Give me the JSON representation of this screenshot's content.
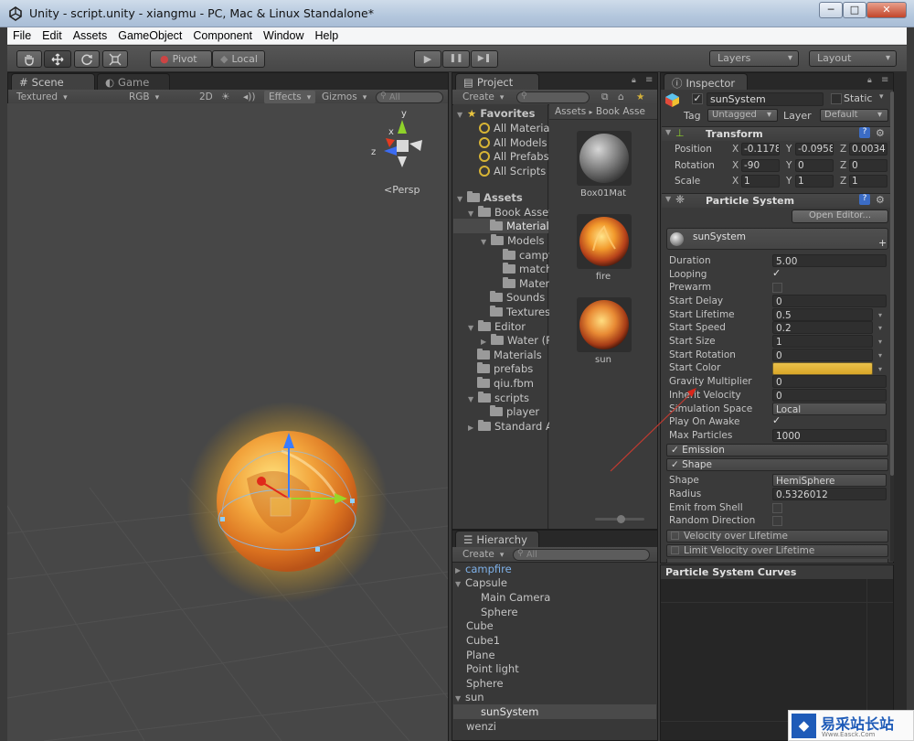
{
  "window": {
    "title": "Unity - script.unity - xiangmu - PC, Mac & Linux Standalone*",
    "controls": [
      "─",
      "□",
      "✕"
    ]
  },
  "menu": [
    "File",
    "Edit",
    "Assets",
    "GameObject",
    "Component",
    "Window",
    "Help"
  ],
  "toolbar": {
    "pivot": "Pivot",
    "local": "Local",
    "play": "▶",
    "pause": "❚❚",
    "step": "▶❚",
    "layers": "Layers",
    "layout": "Layout"
  },
  "scene": {
    "tabs": [
      "Scene",
      "Game"
    ],
    "shading": "Textured",
    "color": "RGB",
    "mode2d": "2D",
    "effects": "Effects",
    "gizmos": "Gizmos",
    "search": "All",
    "persp": "Persp",
    "gizmo_axes": {
      "x": "x",
      "y": "y",
      "z": "z"
    }
  },
  "project": {
    "tab": "Project",
    "create": "Create",
    "breadcrumb": [
      "Assets",
      "Book Asse"
    ],
    "favorites_label": "Favorites",
    "favorites": [
      "All Material",
      "All Models",
      "All Prefabs",
      "All Scripts"
    ],
    "assets_label": "Assets",
    "tree": [
      "Book Asset",
      "Materials",
      "Models",
      "campf",
      "match",
      "Materi",
      "Sounds",
      "Textures",
      "Editor",
      "Water (P",
      "Materials",
      "prefabs",
      "qiu.fbm",
      "scripts",
      "player",
      "Standard A"
    ],
    "thumbs": [
      "Box01Mat",
      "fire",
      "sun"
    ]
  },
  "hierarchy": {
    "tab": "Hierarchy",
    "create": "Create",
    "search": "All",
    "items": [
      "campfire",
      "Capsule",
      "Main Camera",
      "Sphere",
      "Cube",
      "Cube1",
      "Plane",
      "Point light",
      "Sphere",
      "sun",
      "sunSystem",
      "wenzi"
    ]
  },
  "inspector": {
    "tab": "Inspector",
    "object_name": "sunSystem",
    "static": "Static",
    "tag_label": "Tag",
    "tag": "Untagged",
    "layer_label": "Layer",
    "layer": "Default",
    "transform": {
      "title": "Transform",
      "rows": [
        {
          "label": "Position",
          "x": "-0.1178",
          "y": "-0.0958",
          "z": "0.0034"
        },
        {
          "label": "Rotation",
          "x": "-90",
          "y": "0",
          "z": "0"
        },
        {
          "label": "Scale",
          "x": "1",
          "y": "1",
          "z": "1"
        }
      ],
      "axis": [
        "X",
        "Y",
        "Z"
      ]
    },
    "particle": {
      "title": "Particle System",
      "open_editor": "Open Editor...",
      "system_name": "sunSystem",
      "props": [
        {
          "label": "Duration",
          "value": "5.00"
        },
        {
          "label": "Looping",
          "value": "✓"
        },
        {
          "label": "Prewarm",
          "value": ""
        },
        {
          "label": "Start Delay",
          "value": "0"
        },
        {
          "label": "Start Lifetime",
          "value": "0.5"
        },
        {
          "label": "Start Speed",
          "value": "0.2"
        },
        {
          "label": "Start Size",
          "value": "1"
        },
        {
          "label": "Start Rotation",
          "value": "0"
        },
        {
          "label": "Start Color",
          "value": ""
        },
        {
          "label": "Gravity Multiplier",
          "value": "0"
        },
        {
          "label": "Inherit Velocity",
          "value": "0"
        },
        {
          "label": "Simulation Space",
          "value": "Local"
        },
        {
          "label": "Play On Awake",
          "value": "✓"
        },
        {
          "label": "Max Particles",
          "value": "1000"
        }
      ],
      "emission": "Emission",
      "shape": "Shape",
      "shape_props": [
        {
          "label": "Shape",
          "value": "HemiSphere"
        },
        {
          "label": "Radius",
          "value": "0.5326012"
        },
        {
          "label": "Emit from Shell",
          "value": ""
        },
        {
          "label": "Random Direction",
          "value": ""
        }
      ],
      "modules": [
        "Velocity over Lifetime",
        "Limit Velocity over Lifetime"
      ]
    },
    "curves_title": "Particle System Curves"
  },
  "watermark": {
    "brand": "易采站长站",
    "sub": "Www.Easck.Com"
  },
  "colors": {
    "start_color": "#e8b63a",
    "selected_row": "#4a4a4a",
    "prefab_blue": "#7fb2ea"
  }
}
